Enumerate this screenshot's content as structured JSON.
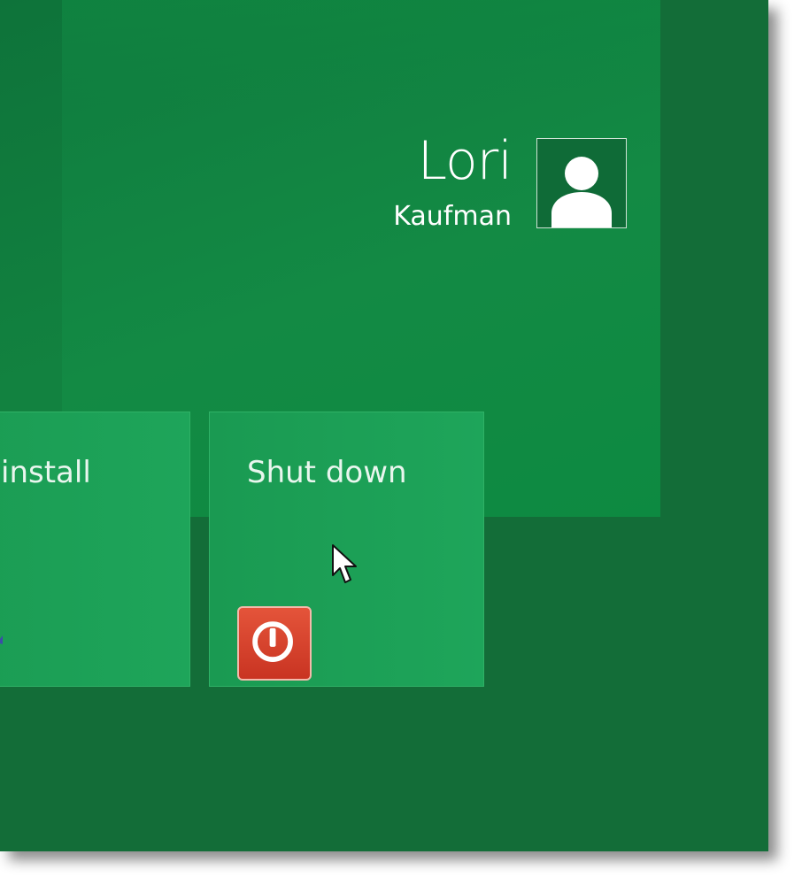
{
  "user": {
    "first_name": "Lori",
    "last_name": "Kaufman",
    "avatar_icon": "user-silhouette-icon"
  },
  "tiles": [
    {
      "label": "install",
      "icon": "uninstall-icon"
    },
    {
      "label": "Shut down",
      "icon": "power-icon"
    }
  ],
  "colors": {
    "background": "#136d38",
    "start_background": "#0f8741",
    "tile": "#1ea55a",
    "power_button": "#d53f28",
    "text": "#ffffff"
  }
}
